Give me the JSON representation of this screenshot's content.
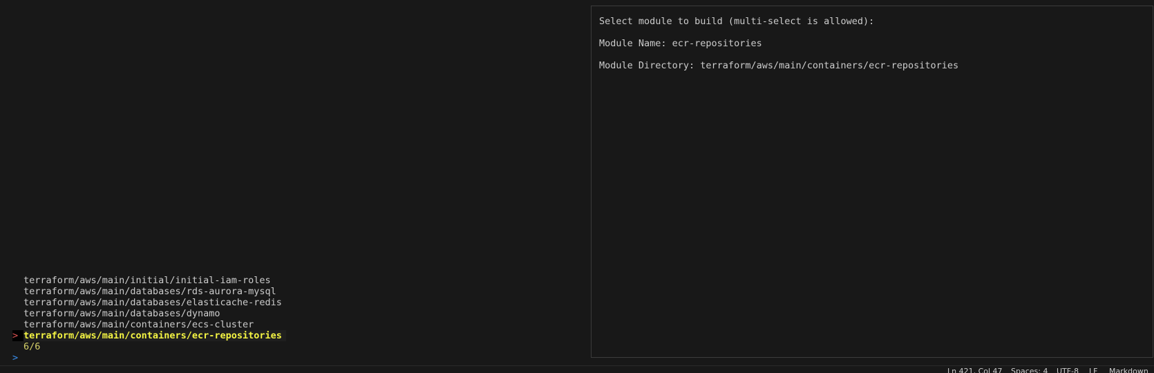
{
  "fzf": {
    "items": [
      "terraform/aws/main/initial/initial-iam-roles",
      "terraform/aws/main/databases/rds-aurora-mysql",
      "terraform/aws/main/databases/elasticache-redis",
      "terraform/aws/main/databases/dynamo",
      "terraform/aws/main/containers/ecs-cluster",
      "terraform/aws/main/containers/ecr-repositories"
    ],
    "selected_pointer": ">",
    "count": "6/6",
    "prompt": ">"
  },
  "preview": {
    "header": "Select module to build (multi-select is allowed):",
    "module_name": "Module Name: ecr-repositories",
    "module_directory": "Module Directory: terraform/aws/main/containers/ecr-repositories"
  },
  "statusbar": {
    "position": "Ln 421, Col 47",
    "spaces": "Spaces: 4",
    "encoding": "UTF-8",
    "eol": "LF",
    "language": "Markdown"
  }
}
